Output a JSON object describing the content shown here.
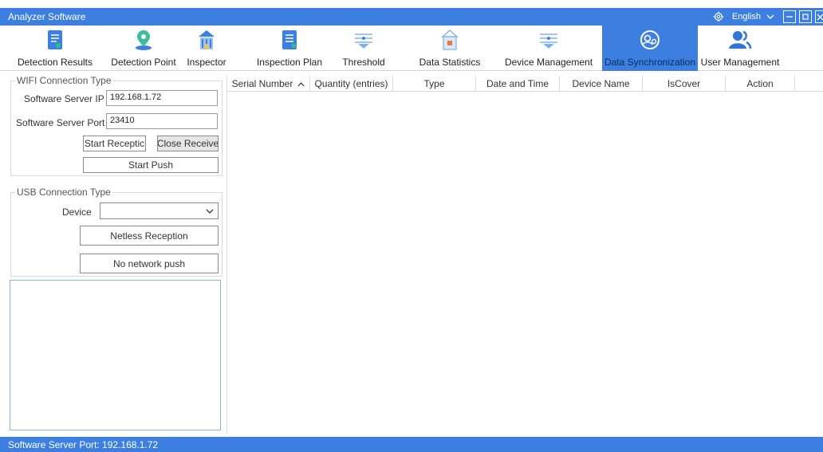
{
  "window": {
    "title": "Analyzer Software",
    "language": "English",
    "colors": {
      "accent": "#3d7fe0",
      "active_tab_text": "#0b2a66"
    }
  },
  "toolbar": {
    "items": [
      {
        "label": "Detection Results",
        "icon": "document-icon"
      },
      {
        "label": "Detection Point",
        "icon": "location-pin-icon"
      },
      {
        "label": "Inspector",
        "icon": "building-icon"
      },
      {
        "label": "Inspection Plan",
        "icon": "clipboard-icon"
      },
      {
        "label": "Threshold",
        "icon": "threshold-icon"
      },
      {
        "label": "Data Statistics",
        "icon": "statistics-icon"
      },
      {
        "label": "Device Management",
        "icon": "device-icon"
      },
      {
        "label": "Data Synchronization",
        "icon": "sync-icon",
        "active": true
      },
      {
        "label": "User Management",
        "icon": "users-icon"
      }
    ]
  },
  "wifi": {
    "legend": "WIFI Connection Type",
    "ip_label": "Software Server IP",
    "ip_value": "192.168.1.72",
    "port_label": "Software Server Port",
    "port_value": "23410",
    "start_reception": "Start Receptic",
    "close_receive": "Close Receive",
    "start_push": "Start Push"
  },
  "usb": {
    "legend": "USB Connection Type",
    "device_label": "Device",
    "device_value": "",
    "netless_reception": "Netless Reception",
    "no_network_push": "No network push"
  },
  "table": {
    "columns": [
      "Serial Number",
      "Quantity (entries)",
      "Type",
      "Date and Time",
      "Device Name",
      "IsCover",
      "Action"
    ]
  },
  "status": {
    "text": "Software Server Port: 192.168.1.72"
  }
}
